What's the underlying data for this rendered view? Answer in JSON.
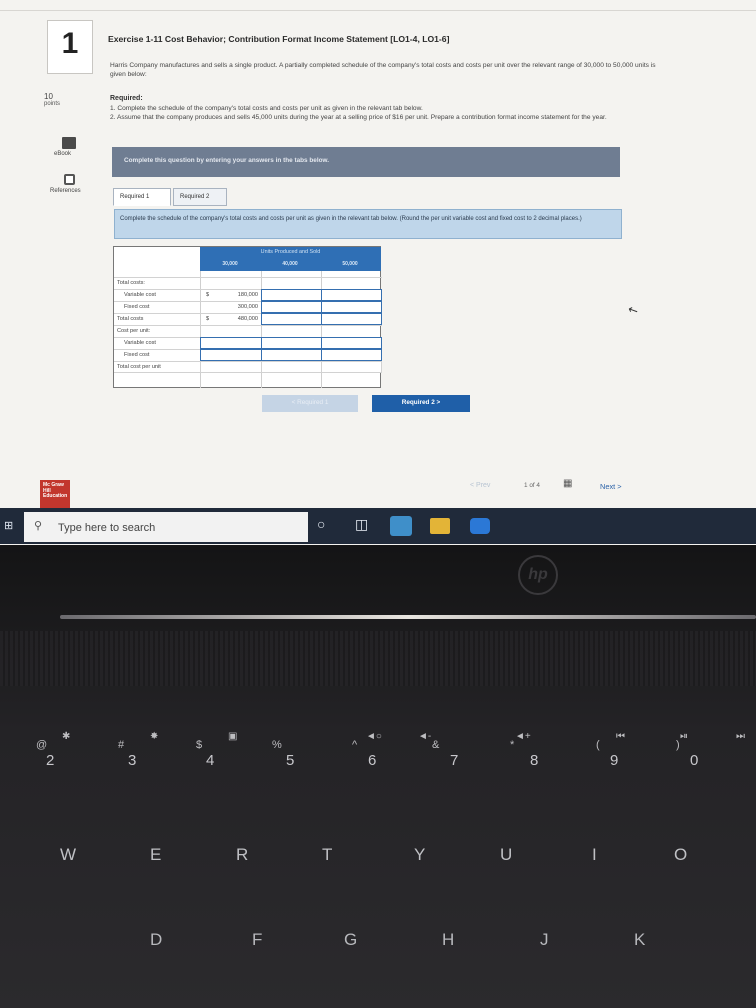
{
  "question": {
    "number": "1",
    "points_value": "10",
    "points_label": "points",
    "title": "Exercise 1-11 Cost Behavior; Contribution Format Income Statement [LO1-4, LO1-6]",
    "intro": "Harris Company manufactures and sells a single product. A partially completed schedule of the company's total costs and costs per unit over the relevant range of 30,000 to 50,000 units is given below:",
    "required_heading": "Required:",
    "required_1": "1. Complete the schedule of the company's total costs and costs per unit as given in the relevant tab below.",
    "required_2": "2. Assume that the company produces and sells 45,000 units during the year at a selling price of $16 per unit. Prepare a contribution format income statement for the year."
  },
  "sidebar": {
    "ebook_label": "eBook",
    "references_label": "References"
  },
  "banner": "Complete this question by entering your answers in the tabs below.",
  "tabs": [
    {
      "label": "Required 1",
      "active": true
    },
    {
      "label": "Required 2",
      "active": false
    }
  ],
  "instruction": "Complete the schedule of the company's total costs and costs per unit as given in the relevant tab below. (Round the per unit variable cost and fixed cost to 2 decimal places.)",
  "schedule": {
    "header_title": "Units Produced and Sold",
    "columns": [
      "30,000",
      "40,000",
      "50,000"
    ],
    "rows": {
      "total_costs_head": "Total costs:",
      "variable_cost": {
        "label": "Variable cost",
        "currency": "$",
        "value": "180,000"
      },
      "fixed_cost": {
        "label": "Fixed cost",
        "value": "300,000"
      },
      "total_costs": {
        "label": "Total costs",
        "currency": "$",
        "value": "480,000"
      },
      "cost_per_unit_head": "Cost per unit:",
      "pu_variable": {
        "label": "Variable cost"
      },
      "pu_fixed": {
        "label": "Fixed cost"
      },
      "pu_total": {
        "label": "Total cost per unit"
      }
    }
  },
  "nav_buttons": {
    "prev_req": "< Required 1",
    "next_req": "Required 2  >"
  },
  "pager": {
    "prev": "< Prev",
    "count": "1 of 4",
    "next": "Next >"
  },
  "brand_logo_text": "Mc Graw Hill Education",
  "taskbar": {
    "search_placeholder": "Type here to search"
  },
  "keyboard": {
    "brand": "hp",
    "numbers": [
      "2",
      "3",
      "4",
      "5",
      "6",
      "7",
      "8",
      "9",
      "0"
    ],
    "symbols": [
      "@",
      "#",
      "$",
      "%",
      "^",
      "&",
      "*",
      "(",
      ")"
    ],
    "row_top": [
      "W",
      "E",
      "R",
      "T",
      "Y",
      "U",
      "I",
      "O"
    ],
    "row_mid": [
      "D",
      "F",
      "G",
      "H",
      "J",
      "K"
    ]
  }
}
